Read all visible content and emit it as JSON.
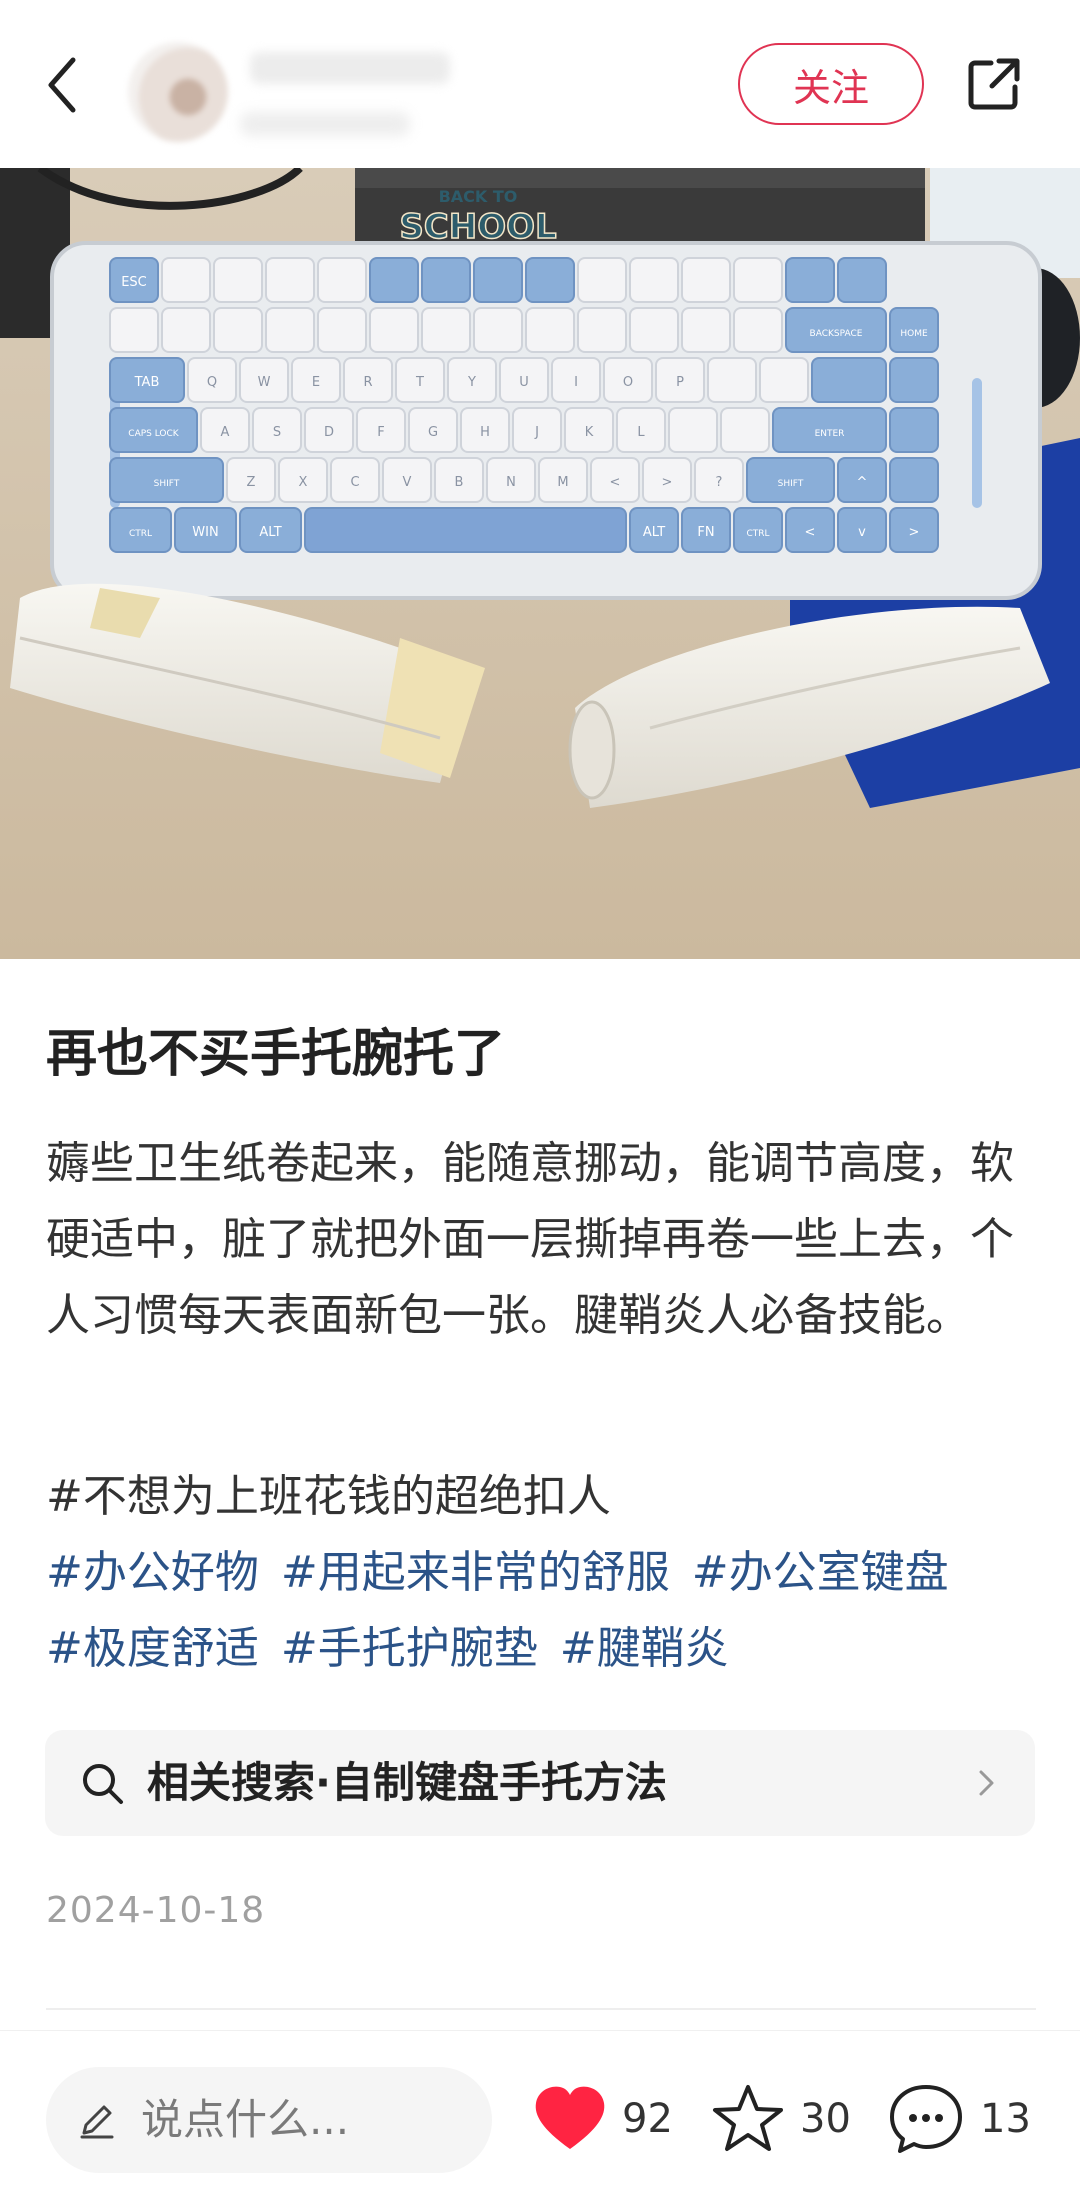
{
  "header": {
    "follow_label": "关注",
    "icons": {
      "back": "chevron-left-icon",
      "share": "share-external-icon"
    }
  },
  "photo": {
    "sticker_top": "BACK TO",
    "sticker_bottom": "SCHOOL",
    "keycaps": {
      "row0": [
        "ESC",
        "",
        "",
        "",
        "",
        "",
        "",
        "",
        "",
        "",
        "",
        "",
        "",
        "",
        ""
      ],
      "row1": [
        "",
        "",
        "",
        "",
        "",
        "",
        "",
        "",
        "",
        "",
        "",
        "",
        "",
        "BACKSPACE",
        "HOME"
      ],
      "row2": [
        "TAB",
        "Q",
        "W",
        "E",
        "R",
        "T",
        "Y",
        "U",
        "I",
        "O",
        "P",
        "",
        "",
        "",
        ""
      ],
      "row3": [
        "CAPS LOCK",
        "A",
        "S",
        "D",
        "F",
        "G",
        "H",
        "J",
        "K",
        "L",
        "",
        "",
        "ENTER",
        ""
      ],
      "row4": [
        "SHIFT",
        "Z",
        "X",
        "C",
        "V",
        "B",
        "N",
        "M",
        "<",
        ">",
        "?",
        "SHIFT",
        "^",
        ""
      ],
      "row5": [
        "CTRL",
        "WIN",
        "ALT",
        "",
        "ALT",
        "FN",
        "CTRL",
        "<",
        "v",
        ">"
      ]
    }
  },
  "post": {
    "title": "再也不买手托腕托了",
    "body": "薅些卫生纸卷起来，能随意挪动，能调节高度，软硬适中，脏了就把外面一层撕掉再卷一些上去，个人习惯每天表面新包一张。腱鞘炎人必备技能。",
    "plain_topic": "#不想为上班花钱的超绝扣人",
    "tags": [
      "#办公好物",
      "#用起来非常的舒服",
      "#办公室键盘",
      "#极度舒适",
      "#手托护腕垫",
      "#腱鞘炎"
    ],
    "related_search": "相关搜索·自制键盘手托方法",
    "date": "2024-10-18"
  },
  "bottom": {
    "comment_placeholder": "说点什么...",
    "likes": "92",
    "favorites": "30",
    "comments": "13",
    "like_color": "#ff2442"
  }
}
